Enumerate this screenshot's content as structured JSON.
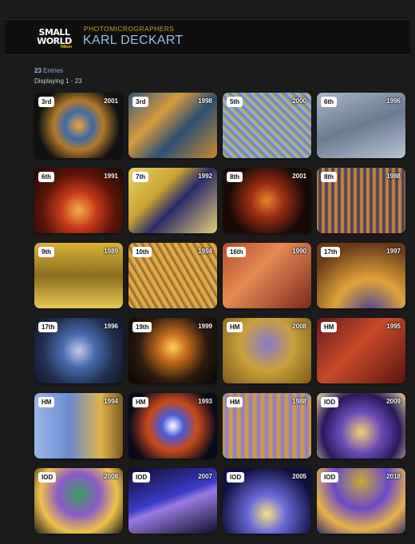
{
  "header": {
    "logo_line1": "SMALL",
    "logo_line2": "WORLD",
    "logo_line3": "Nikon",
    "subtitle": "PHOTOMICROGRAPHERS",
    "title": "KARL DECKART"
  },
  "summary": {
    "count": "23",
    "entries_label": "Entries",
    "displaying": "Displaying 1 - 23"
  },
  "cards": [
    {
      "place": "3rd",
      "year": "2001",
      "bg": "radial-gradient(circle at 50% 50%, #f2a23a 0%, #3d6aa8 25%, #b07a2a 45%, #111 75%)"
    },
    {
      "place": "3rd",
      "year": "1998",
      "bg": "linear-gradient(135deg, #3b5a7a 0%, #d59a3c 35%, #2c4f74 60%, #c88a2e 100%)"
    },
    {
      "place": "5th",
      "year": "2000",
      "bg": "repeating-linear-gradient(45deg, #5d84c6 0px, #9bb6e6 3px, #c0a34a 5px, #5d84c6 8px)"
    },
    {
      "place": "6th",
      "year": "1996",
      "bg": "linear-gradient(160deg, #a9b6c7 0%, #6a7b93 50%, #b8c3d1 100%)"
    },
    {
      "place": "6th",
      "year": "1991",
      "bg": "radial-gradient(circle at 50% 65%, #f3b04a 0%, #c4381a 30%, #5a1408 60%, #1c0603 100%)"
    },
    {
      "place": "7th",
      "year": "1992",
      "bg": "linear-gradient(135deg, #e9d36a 0%, #c9a432 35%, #2a2a6a 55%, #e8d074 100%)"
    },
    {
      "place": "8th",
      "year": "2001",
      "bg": "radial-gradient(circle at 50% 50%, #e7842f 0%, #9c2e12 30%, #1a0a07 70%)"
    },
    {
      "place": "8th",
      "year": "1988",
      "bg": "repeating-linear-gradient(90deg, #d79b2a 0px, #3b2b6a 4px, #d79b2a 8px)"
    },
    {
      "place": "9th",
      "year": "1989",
      "bg": "linear-gradient(180deg, #d9b33a 0%, #8a6e1c 50%, #e7c653 100%)"
    },
    {
      "place": "10th",
      "year": "1994",
      "bg": "repeating-linear-gradient(60deg, #c98a2a 0px, #e7b656 4px, #7a5a22 8px)"
    },
    {
      "place": "16th",
      "year": "1990",
      "bg": "linear-gradient(135deg, #b84a2e 0%, #e58a52 40%, #7c2a1c 100%)"
    },
    {
      "place": "17th",
      "year": "1997",
      "bg": "radial-gradient(circle at 60% 110%, #3d3a9a 0%, #e0a33a 40%, #6a3a1a 80%)"
    },
    {
      "place": "17th",
      "year": "1996",
      "bg": "radial-gradient(circle at 50% 50%, #c8c8e8 0%, #4a6ab0 30%, #223150 65%, #0e1424 100%)"
    },
    {
      "place": "19th",
      "year": "1999",
      "bg": "radial-gradient(circle at 50% 45%, #ffcf5a 0%, #c46a1a 25%, #2a1a10 60%, #0a0604 100%)"
    },
    {
      "place": "HM",
      "year": "2008",
      "bg": "radial-gradient(circle at 50% 40%, #8a7ad0 0%, #c8a03a 45%, #7a5a1a 100%)"
    },
    {
      "place": "HM",
      "year": "1995",
      "bg": "linear-gradient(135deg, #6a1a1a 0%, #c84a2a 45%, #5a1410 100%)"
    },
    {
      "place": "HM",
      "year": "1994",
      "bg": "linear-gradient(90deg, #9ab6e6 0%, #6a8ad0 40%, #e0b24a 75%, #7a5a22 100%)"
    },
    {
      "place": "HM",
      "year": "1993",
      "bg": "radial-gradient(circle at 50% 50%, #fff 0%, #4a5ad8 20%, #c84a1a 45%, #0a0a1a 80%)"
    },
    {
      "place": "HM",
      "year": "1988",
      "bg": "repeating-linear-gradient(90deg, #d6a23a 0px, #8a7acb 5px, #d6a23a 10px)"
    },
    {
      "place": "IOD",
      "year": "2009",
      "bg": "radial-gradient(circle at 50% 60%, #f0d27a 0%, #6a4ab8 35%, #2a1a5a 65%, #e8d0a0 100%)"
    },
    {
      "place": "IOD",
      "year": "2008",
      "bg": "radial-gradient(circle at 50% 40%, #3aa05a 0%, #8a5ac8 35%, #f0c24a 65%, #1a1a1a 100%)"
    },
    {
      "place": "IOD",
      "year": "2007",
      "bg": "linear-gradient(160deg, #0e0e2a 0%, #3a3ac8 45%, #9a7ae0 55%, #0e0e2a 100%)"
    },
    {
      "place": "IOD",
      "year": "2005",
      "bg": "radial-gradient(circle at 50% 70%, #f6e28a 0%, #6a6ad8 30%, #101040 75%)"
    },
    {
      "place": "IOD",
      "year": "2018",
      "bg": "radial-gradient(circle at 50% 20%, #c8a83a 0%, #6a4ac8 40%, #e8b24a 70%, #3a2a6a 100%)"
    }
  ]
}
